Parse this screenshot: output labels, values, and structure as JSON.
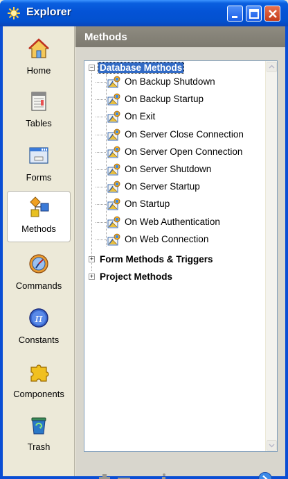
{
  "window": {
    "title": "Explorer"
  },
  "sidebar": {
    "items": [
      {
        "label": "Home",
        "icon": "home-icon"
      },
      {
        "label": "Tables",
        "icon": "tables-icon"
      },
      {
        "label": "Forms",
        "icon": "forms-icon"
      },
      {
        "label": "Methods",
        "icon": "methods-icon",
        "active": true
      },
      {
        "label": "Commands",
        "icon": "commands-icon"
      },
      {
        "label": "Constants",
        "icon": "constants-icon"
      },
      {
        "label": "Components",
        "icon": "components-icon"
      },
      {
        "label": "Trash",
        "icon": "trash-icon"
      }
    ]
  },
  "panel": {
    "title": "Methods",
    "tree": {
      "database_methods": {
        "label": "Database Methods",
        "children": [
          "On Backup Shutdown",
          "On Backup Startup",
          "On Exit",
          "On Server Close Connection",
          "On Server Open Connection",
          "On Server Shutdown",
          "On Server Startup",
          "On Startup",
          "On Web Authentication",
          "On Web Connection"
        ]
      },
      "form_methods": {
        "label": "Form Methods & Triggers"
      },
      "project_methods": {
        "label": "Project Methods"
      }
    }
  },
  "colors": {
    "titlebar": "#0453d6",
    "selection": "#316ac5",
    "panel_header": "#8e8b80"
  }
}
